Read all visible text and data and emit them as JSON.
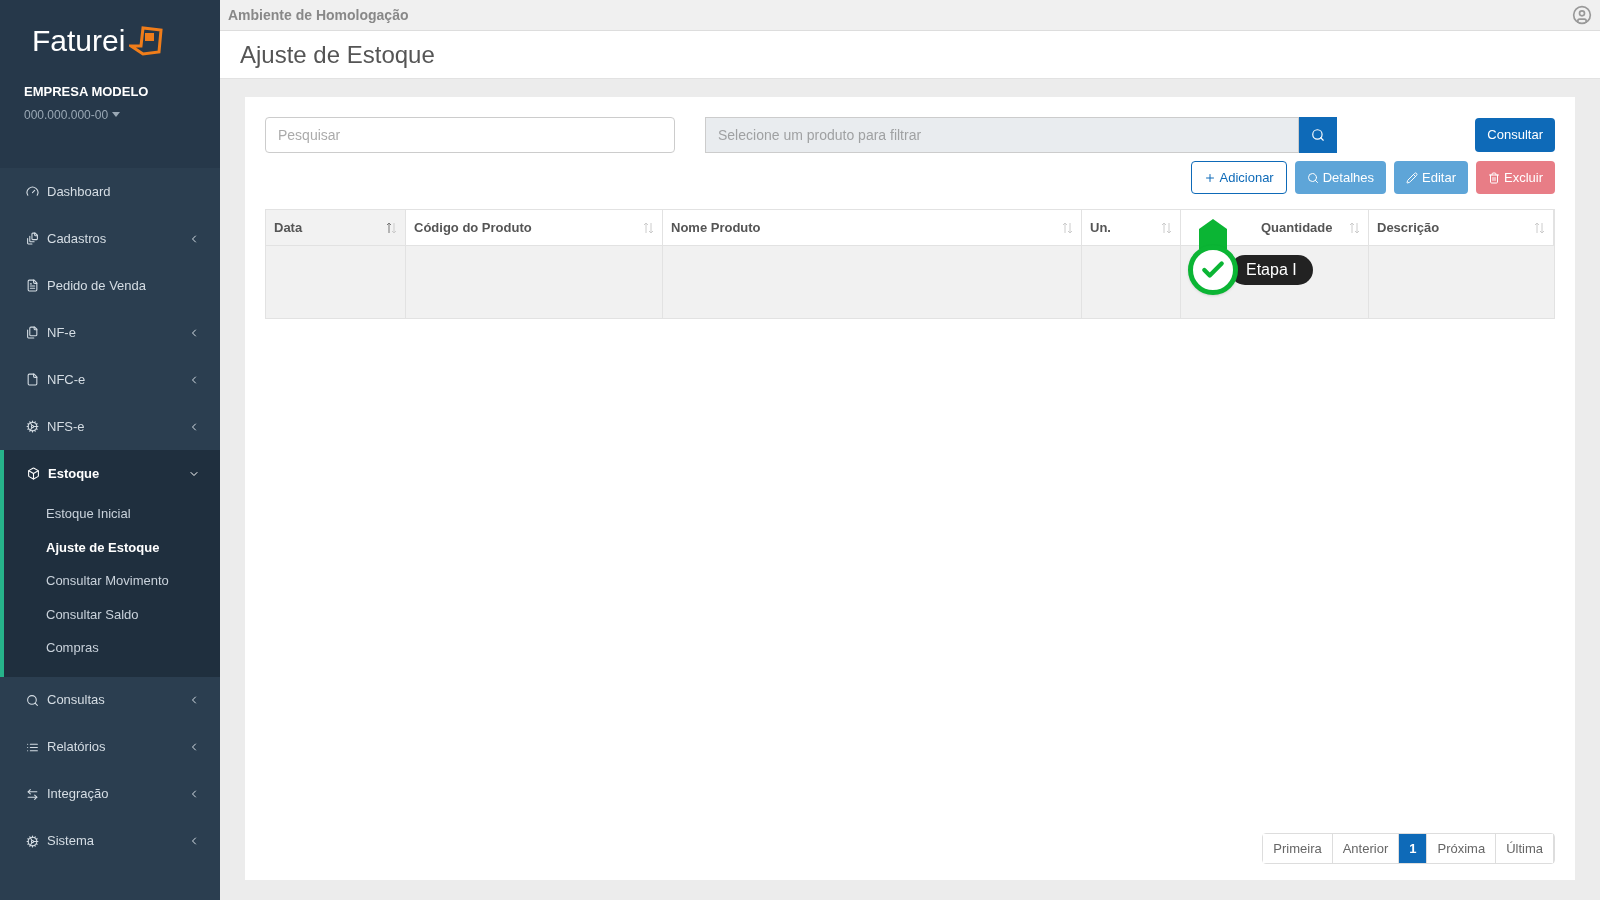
{
  "sidebar": {
    "logo": "Faturei",
    "company": "EMPRESA MODELO",
    "document": "000.000.000-00",
    "items": [
      {
        "label": "Dashboard",
        "has_children": false,
        "expanded": false
      },
      {
        "label": "Cadastros",
        "has_children": true,
        "expanded": false
      },
      {
        "label": "Pedido de Venda",
        "has_children": false,
        "expanded": false
      },
      {
        "label": "NF-e",
        "has_children": true,
        "expanded": false
      },
      {
        "label": "NFC-e",
        "has_children": true,
        "expanded": false
      },
      {
        "label": "NFS-e",
        "has_children": true,
        "expanded": false
      },
      {
        "label": "Estoque",
        "has_children": true,
        "expanded": true,
        "children": [
          {
            "label": "Estoque Inicial",
            "selected": false
          },
          {
            "label": "Ajuste de Estoque",
            "selected": true
          },
          {
            "label": "Consultar Movimento",
            "selected": false
          },
          {
            "label": "Consultar Saldo",
            "selected": false
          },
          {
            "label": "Compras",
            "selected": false
          }
        ]
      },
      {
        "label": "Consultas",
        "has_children": true,
        "expanded": false
      },
      {
        "label": "Relatórios",
        "has_children": true,
        "expanded": false
      },
      {
        "label": "Integração",
        "has_children": true,
        "expanded": false
      },
      {
        "label": "Sistema",
        "has_children": true,
        "expanded": false
      }
    ]
  },
  "environment": "Ambiente de Homologação",
  "page_title": "Ajuste de Estoque",
  "search": {
    "placeholder": "Pesquisar"
  },
  "product_filter": {
    "placeholder": "Selecione um produto para filtrar"
  },
  "consult_button": "Consultar",
  "actions": [
    {
      "label": "Adicionar",
      "kind": "add"
    },
    {
      "label": "Detalhes",
      "kind": "details"
    },
    {
      "label": "Editar",
      "kind": "edit"
    },
    {
      "label": "Excluir",
      "kind": "delete"
    }
  ],
  "table": {
    "columns": [
      {
        "label": "Data",
        "sorted": true
      },
      {
        "label": "Código do Produto",
        "sorted": false
      },
      {
        "label": "Nome Produto",
        "sorted": false
      },
      {
        "label": "Un.",
        "sorted": false
      },
      {
        "label": "Quantidade",
        "sorted": false
      },
      {
        "label": "Descrição",
        "sorted": false
      }
    ]
  },
  "tour_step": {
    "label": "Etapa I",
    "done": true
  },
  "pagination": [
    {
      "label": "Primeira",
      "selected": false
    },
    {
      "label": "Anterior",
      "selected": false
    },
    {
      "label": "1",
      "selected": true
    },
    {
      "label": "Próxima",
      "selected": false
    },
    {
      "label": "Última",
      "selected": false
    }
  ]
}
